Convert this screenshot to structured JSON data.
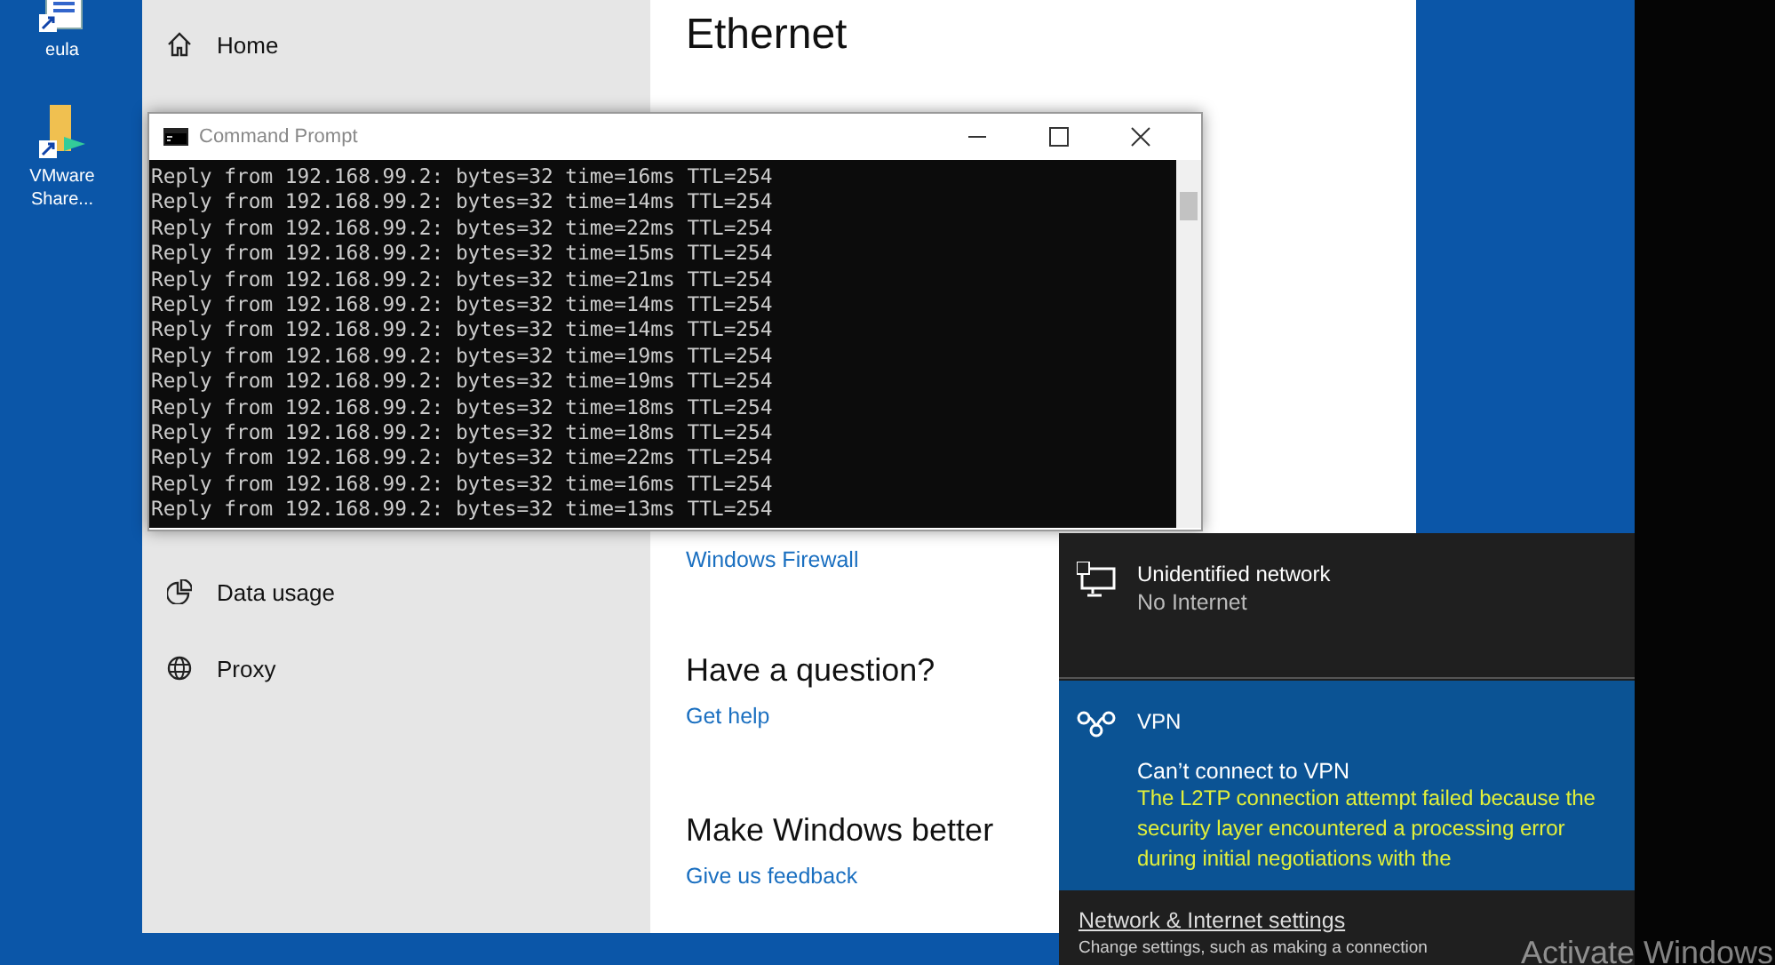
{
  "desktop_icons": [
    {
      "label": "eula",
      "kind": "document"
    },
    {
      "label": "VMware Share...",
      "kind": "folder"
    }
  ],
  "settings": {
    "nav": [
      {
        "label": "Home",
        "kind": "home"
      },
      {
        "label": "Data usage",
        "kind": "pie"
      },
      {
        "label": "Proxy",
        "kind": "globe"
      }
    ],
    "title": "Ethernet",
    "firewall_link": "Windows Firewall",
    "sections": [
      {
        "heading": "Have a question?",
        "link": "Get help"
      },
      {
        "heading": "Make Windows better",
        "link": "Give us feedback"
      }
    ]
  },
  "command_prompt": {
    "title": "Command Prompt",
    "lines": [
      "Reply from 192.168.99.2: bytes=32 time=16ms TTL=254",
      "Reply from 192.168.99.2: bytes=32 time=14ms TTL=254",
      "Reply from 192.168.99.2: bytes=32 time=22ms TTL=254",
      "Reply from 192.168.99.2: bytes=32 time=15ms TTL=254",
      "Reply from 192.168.99.2: bytes=32 time=21ms TTL=254",
      "Reply from 192.168.99.2: bytes=32 time=14ms TTL=254",
      "Reply from 192.168.99.2: bytes=32 time=14ms TTL=254",
      "Reply from 192.168.99.2: bytes=32 time=19ms TTL=254",
      "Reply from 192.168.99.2: bytes=32 time=19ms TTL=254",
      "Reply from 192.168.99.2: bytes=32 time=18ms TTL=254",
      "Reply from 192.168.99.2: bytes=32 time=18ms TTL=254",
      "Reply from 192.168.99.2: bytes=32 time=22ms TTL=254",
      "Reply from 192.168.99.2: bytes=32 time=16ms TTL=254",
      "Reply from 192.168.99.2: bytes=32 time=13ms TTL=254"
    ]
  },
  "network_flyout": {
    "networks": [
      {
        "name": "Unidentified network",
        "status": "No Internet",
        "kind": "ethernet",
        "selected": false
      },
      {
        "name": "VPN",
        "kind": "vpn",
        "selected": true,
        "error_title": "Can’t connect to VPN",
        "error_message": "The L2TP connection attempt failed because the security layer encountered a processing error during initial negotiations with the"
      }
    ],
    "settings_link": "Network & Internet settings",
    "settings_hint": "Change settings, such as making a connection"
  },
  "activation_notice": "Activate Windows"
}
